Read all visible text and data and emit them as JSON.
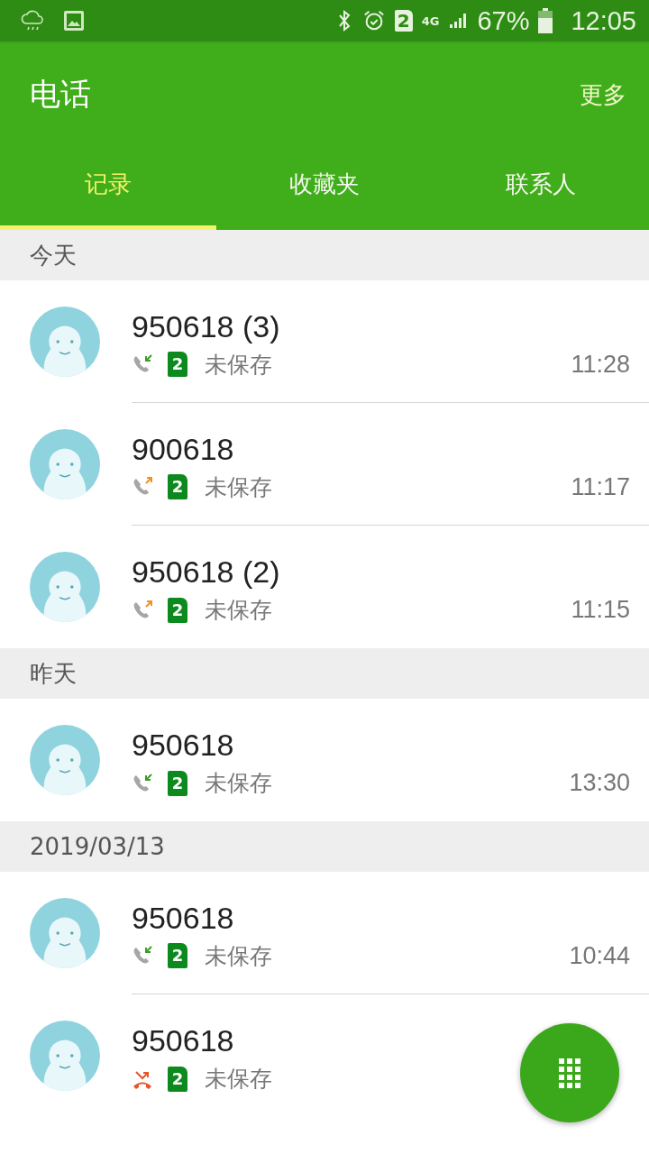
{
  "status_bar": {
    "battery": "67%",
    "time": "12:05",
    "sim": "2",
    "network": "4G"
  },
  "app_bar": {
    "title": "电话",
    "more": "更多"
  },
  "tabs": [
    {
      "label": "记录",
      "selected": true
    },
    {
      "label": "收藏夹",
      "selected": false
    },
    {
      "label": "联系人",
      "selected": false
    }
  ],
  "sections": [
    {
      "header": "今天",
      "calls": [
        {
          "name": "950618 (3)",
          "kind": "incoming",
          "sim": "2",
          "status": "未保存",
          "time": "11:28"
        },
        {
          "name": "900618",
          "kind": "outgoing",
          "sim": "2",
          "status": "未保存",
          "time": "11:17"
        },
        {
          "name": "950618 (2)",
          "kind": "outgoing",
          "sim": "2",
          "status": "未保存",
          "time": "11:15"
        }
      ]
    },
    {
      "header": "昨天",
      "calls": [
        {
          "name": "950618",
          "kind": "incoming",
          "sim": "2",
          "status": "未保存",
          "time": "13:30"
        }
      ]
    },
    {
      "header": "2019/03/13",
      "calls": [
        {
          "name": "950618",
          "kind": "incoming",
          "sim": "2",
          "status": "未保存",
          "time": "10:44"
        },
        {
          "name": "950618",
          "kind": "missed",
          "sim": "2",
          "status": "未保存"
        }
      ]
    }
  ]
}
